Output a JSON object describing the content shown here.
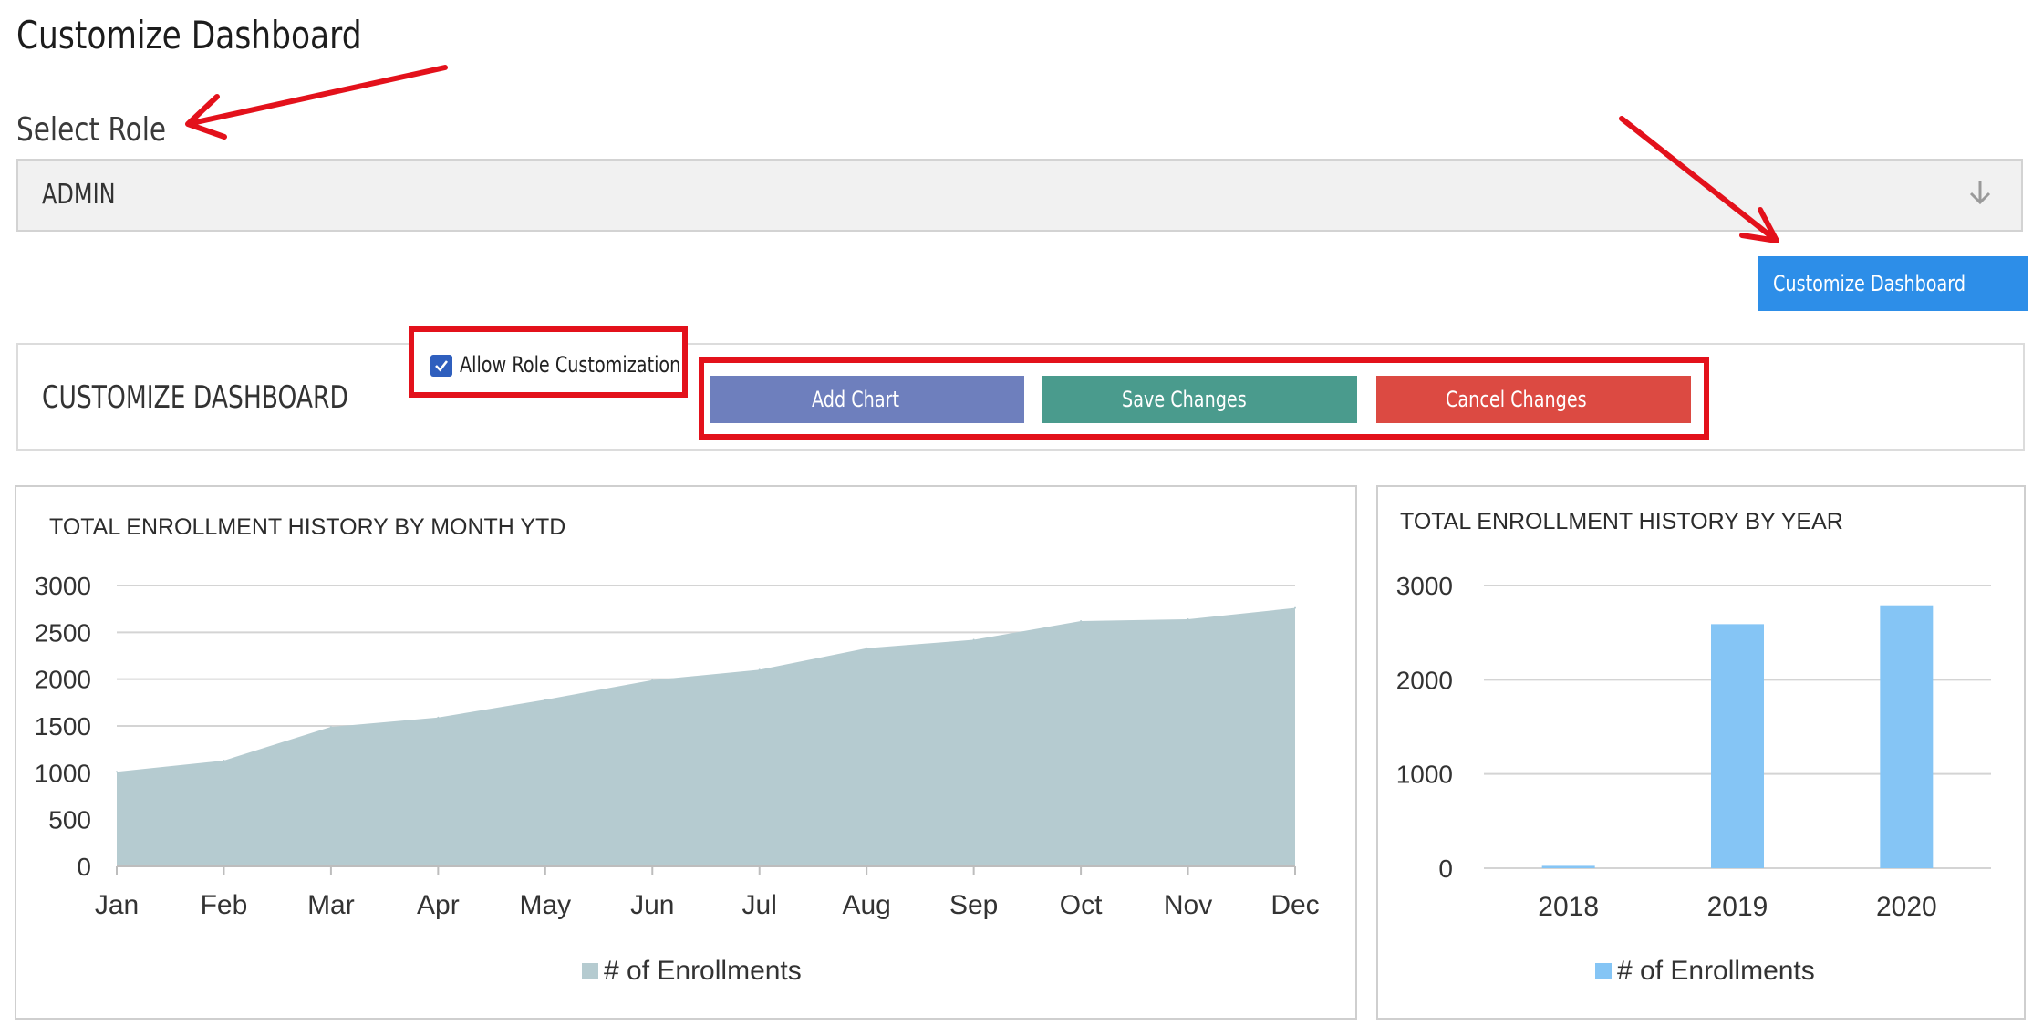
{
  "page": {
    "title": "Customize Dashboard",
    "role_label": "Select Role",
    "role_selected": "ADMIN",
    "customize_button": "Customize Dashboard"
  },
  "customize_panel": {
    "title": "CUSTOMIZE DASHBOARD",
    "allow_role_customization": {
      "label": "Allow Role Customization",
      "checked": true
    },
    "buttons": {
      "add_chart": "Add Chart",
      "save_changes": "Save Changes",
      "cancel_changes": "Cancel Changes"
    },
    "button_colors": {
      "add_chart": "#6e7fbd",
      "save_changes": "#4a9b8d",
      "cancel_changes": "#dc4a42"
    }
  },
  "icons": {
    "select_chevron": "arrow-down-icon",
    "checkbox": "checkmark-icon"
  },
  "annotation_color": "#e3111b",
  "chart_data": [
    {
      "type": "area",
      "title": "TOTAL ENROLLMENT HISTORY BY MONTH YTD",
      "categories": [
        "Jan",
        "Feb",
        "Mar",
        "Apr",
        "May",
        "Jun",
        "Jul",
        "Aug",
        "Sep",
        "Oct",
        "Nov",
        "Dec"
      ],
      "series": [
        {
          "name": "# of Enrollments",
          "values": [
            1010,
            1130,
            1490,
            1590,
            1780,
            1990,
            2100,
            2330,
            2420,
            2620,
            2640,
            2760
          ],
          "color": "#b5cbd0"
        }
      ],
      "yticks": [
        "0",
        "500",
        "1000",
        "1500",
        "2000",
        "2500",
        "3000"
      ],
      "ylim": [
        0,
        3000
      ],
      "grid": true,
      "legend": "bottom"
    },
    {
      "type": "bar",
      "title": "TOTAL ENROLLMENT HISTORY BY YEAR",
      "categories": [
        "2018",
        "2019",
        "2020"
      ],
      "series": [
        {
          "name": "# of Enrollments",
          "values": [
            25,
            2590,
            2790
          ],
          "color": "#85c5f5"
        }
      ],
      "yticks": [
        "0",
        "1000",
        "2000",
        "3000"
      ],
      "ylim": [
        0,
        3000
      ],
      "grid": true,
      "legend": "bottom"
    }
  ]
}
